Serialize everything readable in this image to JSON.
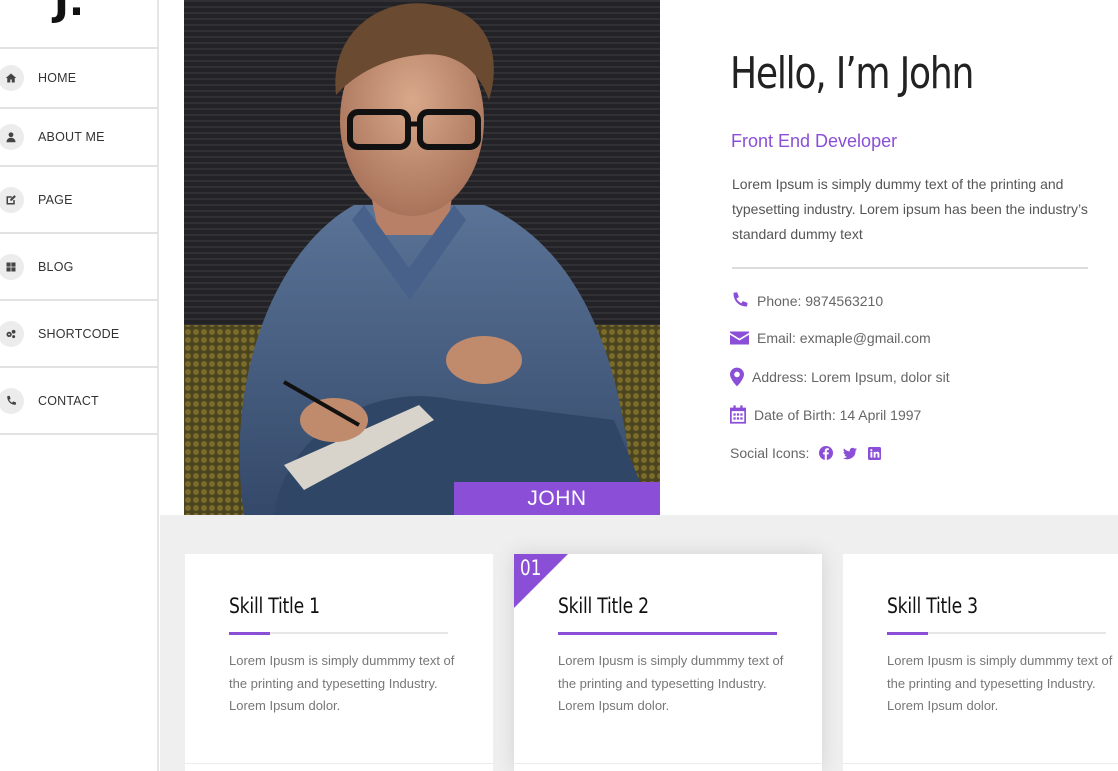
{
  "brand": {
    "logo": "J."
  },
  "nav": {
    "items": [
      {
        "label": "HOME",
        "icon": "home-icon"
      },
      {
        "label": "ABOUT ME",
        "icon": "user-icon"
      },
      {
        "label": "PAGE",
        "icon": "edit-icon"
      },
      {
        "label": "BLOG",
        "icon": "grid-icon"
      },
      {
        "label": "SHORTCODE",
        "icon": "gears-icon"
      },
      {
        "label": "CONTACT",
        "icon": "phone-icon"
      }
    ]
  },
  "profile": {
    "photo_label": "JOHN",
    "greeting": "Hello, I’m John",
    "role": "Front End Developer",
    "bio": "Lorem Ipsum is simply dummy text of the printing and typesetting industry. Lorem ipsum has been the industry’s standard dummy text",
    "phone": "Phone: 9874563210",
    "email": "Email: exmaple@gmail.com",
    "address": "Address: Lorem Ipsum, dolor sit",
    "dob": "Date of Birth: 14 April 1997",
    "social_label": "Social Icons:",
    "social": [
      "facebook-icon",
      "twitter-icon",
      "linkedin-icon"
    ]
  },
  "skills": [
    {
      "title": "Skill Title 1",
      "text": "Lorem Ipusm is simply dummmy text of the printing and typesetting Industry. Lorem Ipsum dolor."
    },
    {
      "title": "Skill Title 2",
      "badge": "01",
      "text": "Lorem Ipusm is simply dummmy text of the printing and typesetting Industry. Lorem Ipsum dolor."
    },
    {
      "title": "Skill Title 3",
      "text": "Lorem Ipusm is simply dummmy text of the printing and typesetting Industry. Lorem Ipsum dolor."
    }
  ],
  "colors": {
    "accent": "#8a4fd6",
    "heading": "#222222",
    "text": "#555555"
  }
}
